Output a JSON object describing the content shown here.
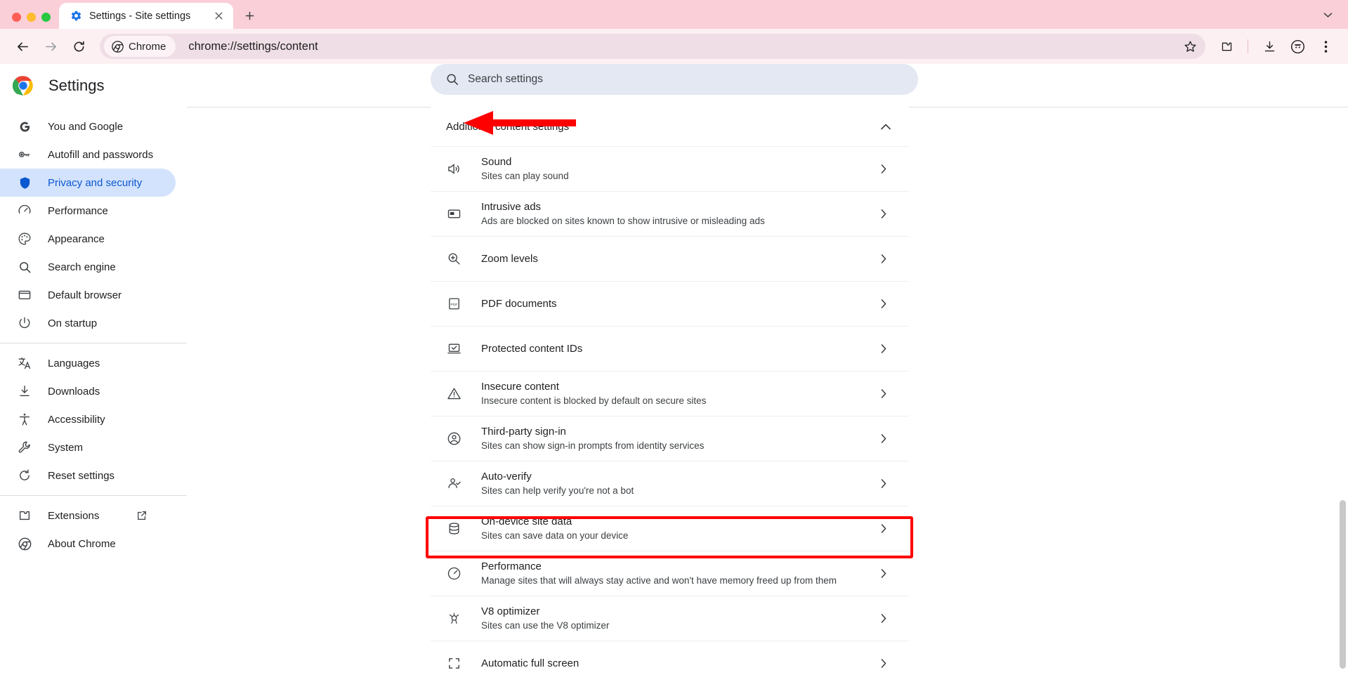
{
  "browser": {
    "tab": {
      "title": "Settings - Site settings",
      "favicon": "settings-gear-icon"
    },
    "newtab_label": "+",
    "omnibox": {
      "chrome_chip_label": "Chrome",
      "url": "chrome://settings/content"
    },
    "toolbar_icons": [
      "back-icon",
      "forward-icon",
      "reload-icon",
      "bookmark-star-icon",
      "extensions-puzzle-icon",
      "downloads-icon",
      "profile-avatar-icon",
      "more-menu-icon"
    ]
  },
  "settings": {
    "title": "Settings",
    "search": {
      "placeholder": "Search settings",
      "value": ""
    }
  },
  "sidebar": {
    "groups": [
      {
        "items": [
          {
            "label": "You and Google",
            "icon": "google-g-icon",
            "active": false
          },
          {
            "label": "Autofill and passwords",
            "icon": "key-icon",
            "active": false
          },
          {
            "label": "Privacy and security",
            "icon": "shield-icon",
            "active": true
          },
          {
            "label": "Performance",
            "icon": "speedometer-icon",
            "active": false
          },
          {
            "label": "Appearance",
            "icon": "palette-icon",
            "active": false
          },
          {
            "label": "Search engine",
            "icon": "search-icon",
            "active": false
          },
          {
            "label": "Default browser",
            "icon": "window-icon",
            "active": false
          },
          {
            "label": "On startup",
            "icon": "power-icon",
            "active": false
          }
        ]
      },
      {
        "items": [
          {
            "label": "Languages",
            "icon": "translate-icon",
            "active": false
          },
          {
            "label": "Downloads",
            "icon": "download-icon",
            "active": false
          },
          {
            "label": "Accessibility",
            "icon": "accessibility-icon",
            "active": false
          },
          {
            "label": "System",
            "icon": "wrench-icon",
            "active": false
          },
          {
            "label": "Reset settings",
            "icon": "reset-icon",
            "active": false
          }
        ]
      },
      {
        "items": [
          {
            "label": "Extensions",
            "icon": "puzzle-icon",
            "active": false,
            "external": true
          },
          {
            "label": "About Chrome",
            "icon": "chrome-icon",
            "active": false
          }
        ]
      }
    ]
  },
  "content": {
    "section_title": "Additional content settings",
    "section_expanded": true,
    "rows": [
      {
        "title": "Sound",
        "sub": "Sites can play sound",
        "icon": "volume-icon",
        "highlighted": false
      },
      {
        "title": "Intrusive ads",
        "sub": "Ads are blocked on sites known to show intrusive or misleading ads",
        "icon": "ads-window-icon",
        "highlighted": false
      },
      {
        "title": "Zoom levels",
        "sub": "",
        "icon": "zoom-in-icon",
        "highlighted": false
      },
      {
        "title": "PDF documents",
        "sub": "",
        "icon": "pdf-icon",
        "highlighted": false
      },
      {
        "title": "Protected content IDs",
        "sub": "",
        "icon": "protected-content-icon",
        "highlighted": false
      },
      {
        "title": "Insecure content",
        "sub": "Insecure content is blocked by default on secure sites",
        "icon": "warning-triangle-icon",
        "highlighted": false
      },
      {
        "title": "Third-party sign-in",
        "sub": "Sites can show sign-in prompts from identity services",
        "icon": "account-circle-icon",
        "highlighted": false
      },
      {
        "title": "Auto-verify",
        "sub": "Sites can help verify you're not a bot",
        "icon": "person-check-icon",
        "highlighted": false
      },
      {
        "title": "On-device site data",
        "sub": "Sites can save data on your device",
        "icon": "database-icon",
        "highlighted": true
      },
      {
        "title": "Performance",
        "sub": "Manage sites that will always stay active and won't have memory freed up from them",
        "icon": "speedometer-icon",
        "highlighted": false
      },
      {
        "title": "V8 optimizer",
        "sub": "Sites can use the V8 optimizer",
        "icon": "v8-icon",
        "highlighted": false
      },
      {
        "title": "Automatic full screen",
        "sub": "",
        "icon": "fullscreen-icon",
        "highlighted": false
      }
    ]
  },
  "annotations": {
    "arrow_color": "#ff0000",
    "arrow_target": "Additional content settings",
    "highlight_color": "#ff0000",
    "highlight_target": "On-device site data"
  }
}
